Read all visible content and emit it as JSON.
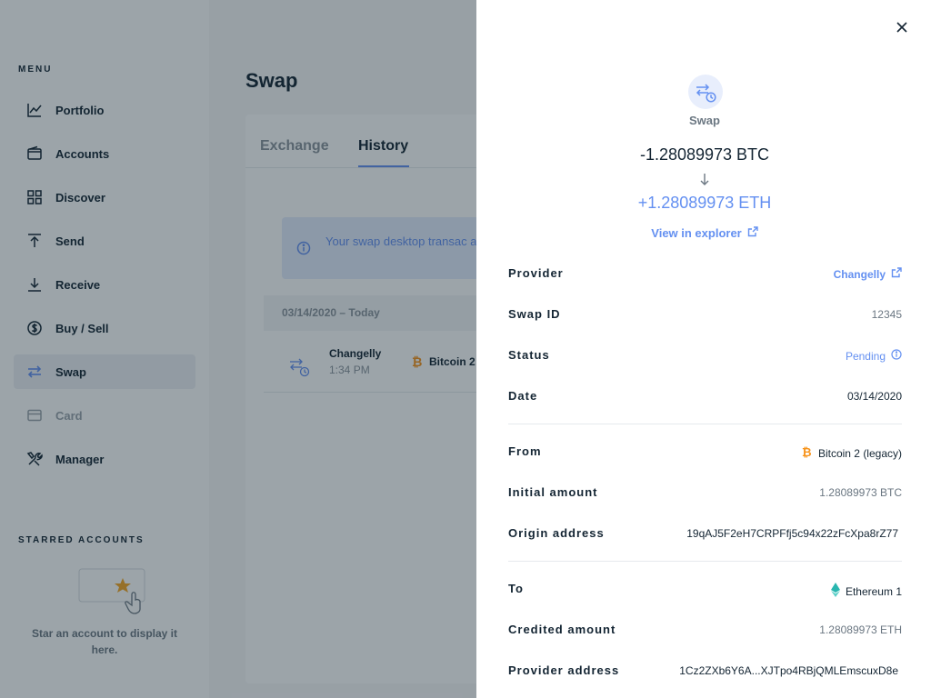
{
  "sidebar": {
    "menu_heading": "MENU",
    "items": [
      {
        "label": "Portfolio",
        "icon": "chart-icon"
      },
      {
        "label": "Accounts",
        "icon": "wallet-icon"
      },
      {
        "label": "Discover",
        "icon": "grid-icon"
      },
      {
        "label": "Send",
        "icon": "send-icon"
      },
      {
        "label": "Receive",
        "icon": "receive-icon"
      },
      {
        "label": "Buy / Sell",
        "icon": "dollar-icon"
      },
      {
        "label": "Swap",
        "icon": "swap-icon",
        "active": true
      },
      {
        "label": "Card",
        "icon": "card-icon",
        "disabled": true
      },
      {
        "label": "Manager",
        "icon": "tools-icon"
      }
    ],
    "starred_heading": "STARRED ACCOUNTS",
    "starred_empty_text": "Star an account to display it here."
  },
  "main": {
    "title": "Swap",
    "tabs": [
      {
        "label": "Exchange"
      },
      {
        "label": "History",
        "active": true
      }
    ],
    "banner_text": "Your swap desktop transac application",
    "history": {
      "date_label": "03/14/2020 – Today",
      "rows": [
        {
          "provider": "Changelly",
          "time": "1:34 PM",
          "account": "Bitcoin 2"
        }
      ]
    }
  },
  "drawer": {
    "header_label": "Swap",
    "amount_from": "-1.28089973 BTC",
    "amount_to": "+1.28089973 ETH",
    "explorer_link": "View in explorer",
    "details": {
      "provider": {
        "label": "Provider",
        "value": "Changelly"
      },
      "swap_id": {
        "label": "Swap ID",
        "value": "12345"
      },
      "status": {
        "label": "Status",
        "value": "Pending"
      },
      "date": {
        "label": "Date",
        "value": "03/14/2020"
      },
      "from": {
        "label": "From",
        "value": "Bitcoin 2 (legacy)"
      },
      "initial_amount": {
        "label": "Initial amount",
        "value": "1.28089973 BTC"
      },
      "origin_address": {
        "label": "Origin address",
        "value": "19qAJ5F2eH7CRPFfj5c94x22zFcXpa8rZ77"
      },
      "to": {
        "label": "To",
        "value": "Ethereum 1"
      },
      "credited_amount": {
        "label": "Credited amount",
        "value": "1.28089973 ETH"
      },
      "provider_address": {
        "label": "Provider address",
        "value": "1Cz2ZXb6Y6A...XJTpo4RBjQMLEmscuxD8e"
      }
    }
  },
  "colors": {
    "accent": "#6490f1",
    "text": "#142533",
    "muted": "#6b7782",
    "bitcoin": "#f7931a",
    "ethereum": "#29b6af",
    "overlay": "rgba(20,37,51,0.42)"
  }
}
